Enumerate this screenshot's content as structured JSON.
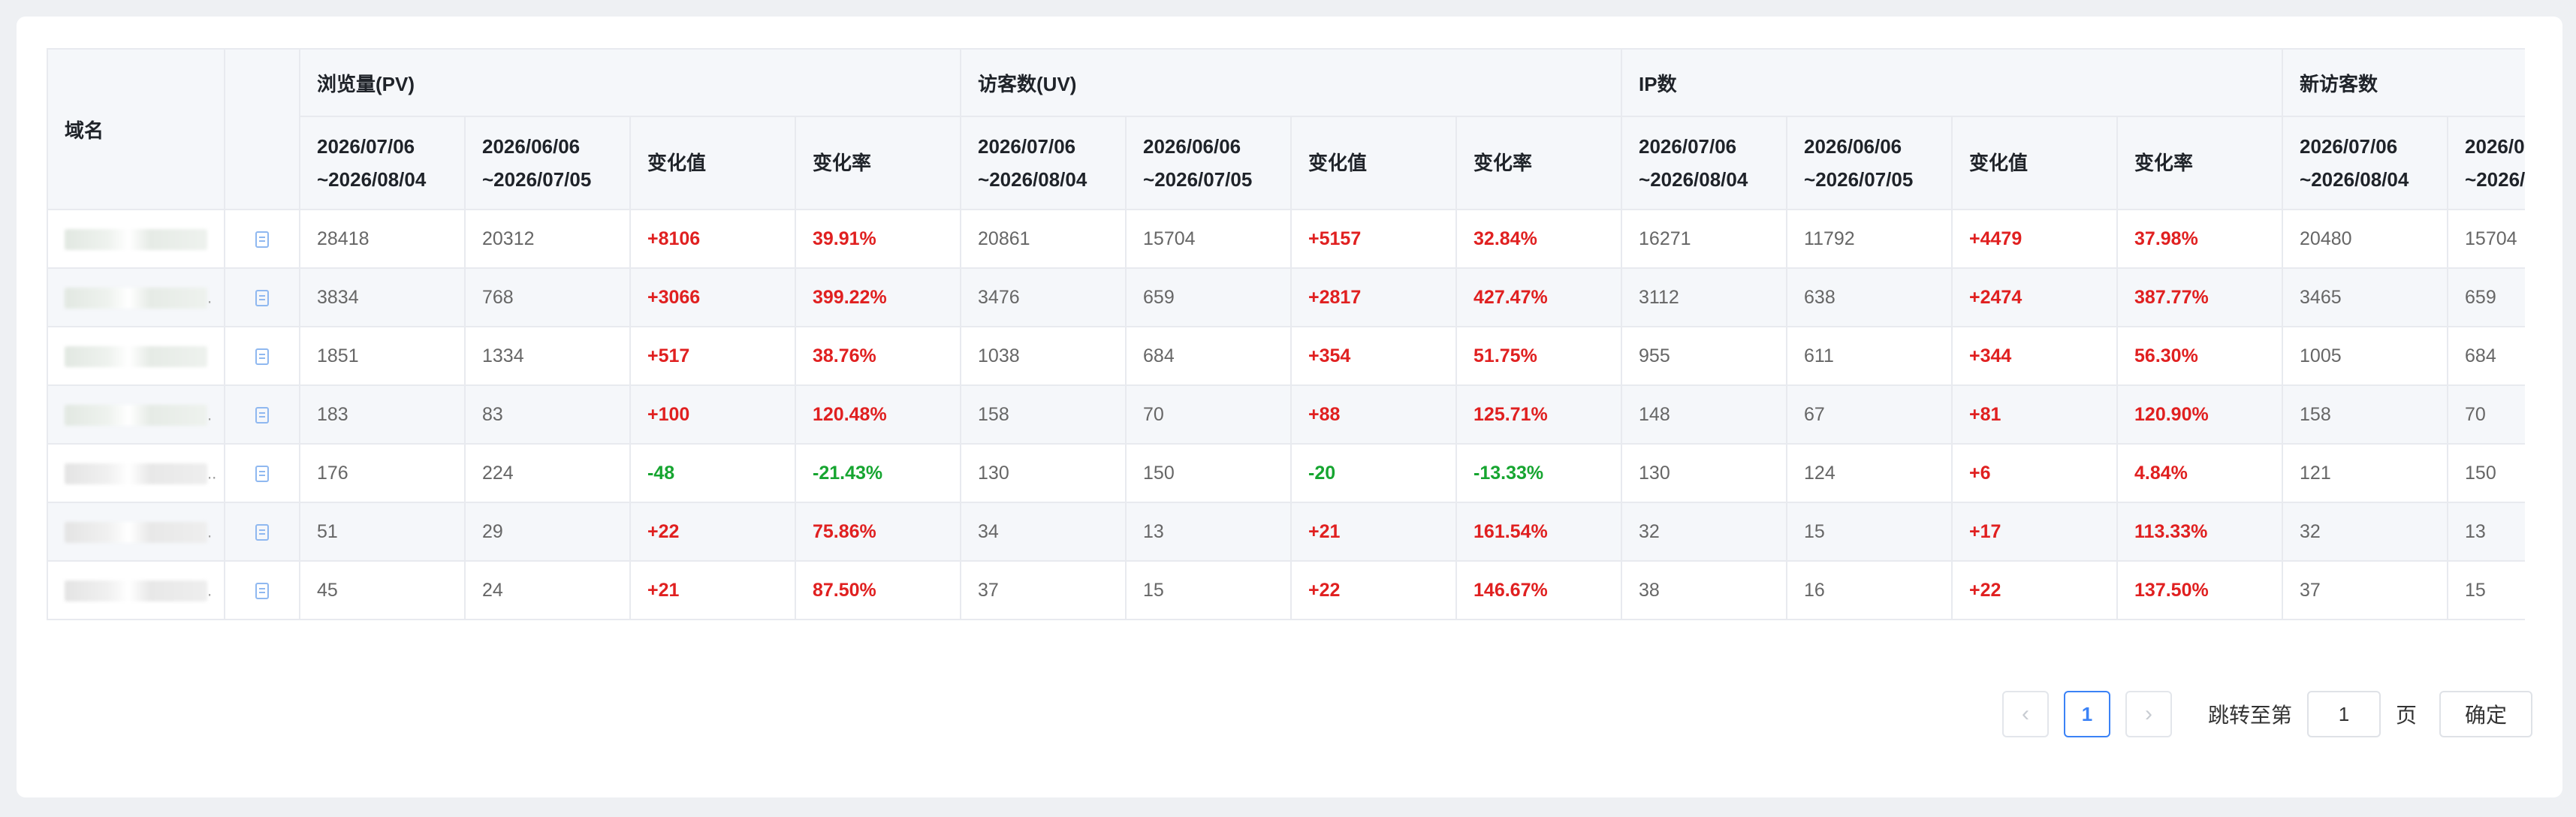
{
  "table": {
    "domain_header": "域名",
    "groups": [
      {
        "label": "浏览量(PV)"
      },
      {
        "label": "访客数(UV)"
      },
      {
        "label": "IP数"
      },
      {
        "label": "新访客数"
      }
    ],
    "sub_headers": {
      "current_period": [
        "2026/07/06",
        "~2026/08/04"
      ],
      "previous_period": [
        "2026/06/06",
        "~2026/07/05"
      ],
      "change_value": "变化值",
      "change_rate": "变化率"
    },
    "rows": [
      {
        "pv": [
          "28418",
          "20312",
          "+8106",
          "39.91%"
        ],
        "uv": [
          "20861",
          "15704",
          "+5157",
          "32.84%"
        ],
        "ip": [
          "16271",
          "11792",
          "+4479",
          "37.98%"
        ],
        "new": [
          "20480",
          "15704"
        ]
      },
      {
        "pv": [
          "3834",
          "768",
          "+3066",
          "399.22%"
        ],
        "uv": [
          "3476",
          "659",
          "+2817",
          "427.47%"
        ],
        "ip": [
          "3112",
          "638",
          "+2474",
          "387.77%"
        ],
        "new": [
          "3465",
          "659"
        ]
      },
      {
        "pv": [
          "1851",
          "1334",
          "+517",
          "38.76%"
        ],
        "uv": [
          "1038",
          "684",
          "+354",
          "51.75%"
        ],
        "ip": [
          "955",
          "611",
          "+344",
          "56.30%"
        ],
        "new": [
          "1005",
          "684"
        ]
      },
      {
        "pv": [
          "183",
          "83",
          "+100",
          "120.48%"
        ],
        "uv": [
          "158",
          "70",
          "+88",
          "125.71%"
        ],
        "ip": [
          "148",
          "67",
          "+81",
          "120.90%"
        ],
        "new": [
          "158",
          "70"
        ]
      },
      {
        "pv": [
          "176",
          "224",
          "-48",
          "-21.43%"
        ],
        "uv": [
          "130",
          "150",
          "-20",
          "-13.33%"
        ],
        "ip": [
          "130",
          "124",
          "+6",
          "4.84%"
        ],
        "new": [
          "121",
          "150"
        ]
      },
      {
        "pv": [
          "51",
          "29",
          "+22",
          "75.86%"
        ],
        "uv": [
          "34",
          "13",
          "+21",
          "161.54%"
        ],
        "ip": [
          "32",
          "15",
          "+17",
          "113.33%"
        ],
        "new": [
          "32",
          "13"
        ]
      },
      {
        "pv": [
          "45",
          "24",
          "+21",
          "87.50%"
        ],
        "uv": [
          "37",
          "15",
          "+22",
          "146.67%"
        ],
        "ip": [
          "38",
          "16",
          "+22",
          "137.50%"
        ],
        "new": [
          "37",
          "15"
        ]
      }
    ]
  },
  "pagination": {
    "prev_icon": "chevron-left-icon",
    "current_page": "1",
    "next_icon": "chevron-right-icon",
    "jump_label": "跳转至第",
    "jump_value": "1",
    "page_suffix": "页",
    "confirm_label": "确定"
  },
  "colors": {
    "positive": "#e02020",
    "negative": "#16a530",
    "accent": "#3b82f6"
  }
}
